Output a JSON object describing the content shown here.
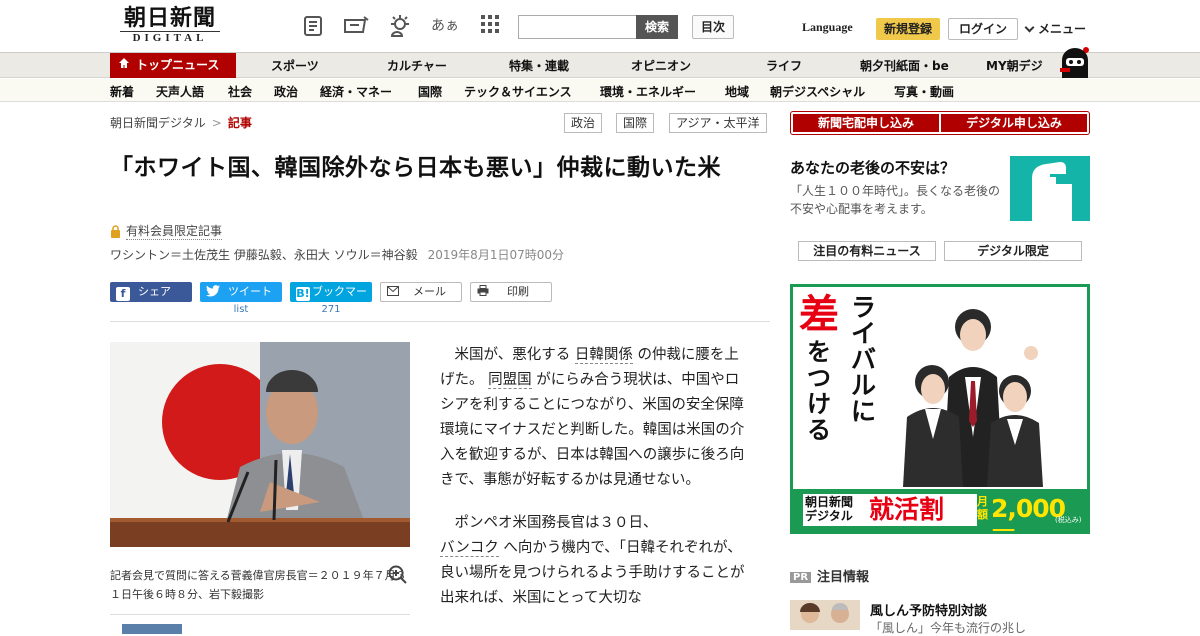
{
  "header": {
    "logo_jp": "朝日新聞",
    "logo_en": "DIGITAL",
    "search_button": "検索",
    "search_placeholder": "",
    "toc_button": "目次",
    "language": "Language",
    "register": "新規登録",
    "login": "ログイン",
    "menu": "メニュー",
    "icons": [
      "paper-icon",
      "coupon-icon",
      "weather-icon",
      "font-size-icon",
      "grid-menu-icon"
    ],
    "font_size_glyph": "あぁ"
  },
  "nav": {
    "home": "トップニュース",
    "items": [
      "スポーツ",
      "カルチャー",
      "特集・連載",
      "オピニオン",
      "ライフ",
      "朝夕刊紙面・be",
      "MY朝デジ"
    ],
    "sub_items": [
      "新着",
      "天声人語",
      "社会",
      "政治",
      "経済・マネー",
      "国際",
      "テック＆サイエンス",
      "環境・エネルギー",
      "地域",
      "朝デジスペシャル",
      "写真・動画"
    ]
  },
  "breadcrumb": {
    "root": "朝日新聞デジタル",
    "separator": ">",
    "current": "記事"
  },
  "tags": [
    "政治",
    "国際",
    "アジア・太平洋"
  ],
  "article": {
    "headline": "「ホワイト国、韓国除外なら日本も悪い」仲裁に動いた米",
    "paid_label": "有料会員限定記事",
    "byline": "ワシントン＝土佐茂生 伊藤弘毅、永田大 ソウル＝神谷毅",
    "date": "2019年8月1日07時00分",
    "share": {
      "facebook": "シェア",
      "twitter": "ツイート",
      "twitter_count": "list",
      "hatena": "ブックマーク",
      "hatena_count": "271",
      "mail": "メール",
      "print": "印刷"
    },
    "photo_caption": "記者会見で質問に答える菅義偉官房長官＝２０１９年７月３１日午後６時８分、岩下毅撮影",
    "paragraph1": {
      "t1": "米国が、悪化する",
      "k1": "日韓関係",
      "t2": "の仲裁に腰を上げた。",
      "k2": "同盟国",
      "t3": "がにらみ合う現状は、中国やロシアを利することにつながり、米国の安全保障環境にマイナスだと判断した。韓国は米国の介入を歓迎するが、日本は韓国への譲歩に後ろ向きで、事態が好転するかは見通せない。"
    },
    "paragraph2": {
      "t1": "ポンペオ米国務長官は３０日、",
      "k1": "バンコク",
      "t2": "へ向かう機内で、「日韓それぞれが、良い場所を見つけられるよう手助けすることが出来れば、米国にとって大切な"
    }
  },
  "sidebar": {
    "subscribe_paper": "新聞宅配申し込み",
    "subscribe_digital": "デジタル申し込み",
    "promo_title": "あなたの老後の不安は？",
    "promo_desc": "「人生１００年時代」。長くなる老後の不安や心配事を考えます。",
    "tab_paid": "注目の有料ニュース",
    "tab_digital": "デジタル限定",
    "ad": {
      "headline_big": "差",
      "headline_rest1": "をつける",
      "headline_rest2": "ライバルに",
      "brand": "朝日新聞デジタル",
      "campaign": "就活割",
      "price_label": "月額",
      "price": "2,000円",
      "tax": "(税込み)"
    },
    "pr_badge": "PR",
    "pr_title": "注目情報",
    "news_title": "風しん予防特別対談",
    "news_desc": "「風しん」今年も流行の兆し"
  },
  "colors": {
    "brand_red": "#b10000",
    "register_yellow": "#f0c84a",
    "ad_green": "#1a9a52",
    "promo_teal": "#15b4a8"
  }
}
